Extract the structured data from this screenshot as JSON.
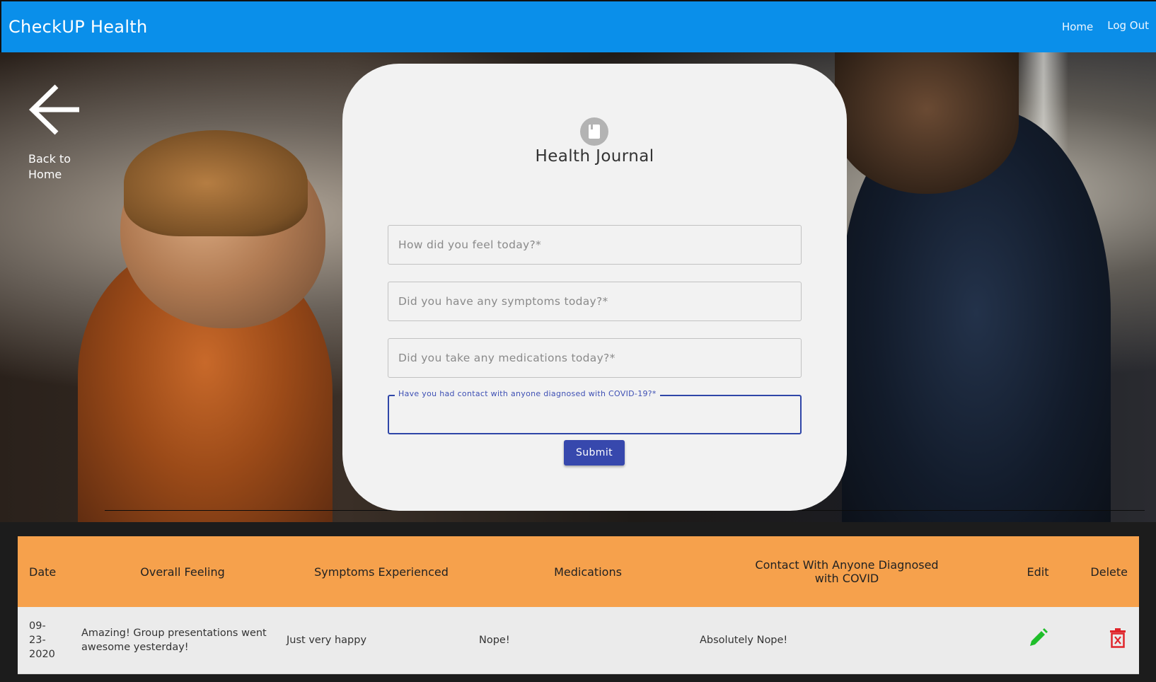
{
  "navbar": {
    "brand": "CheckUP Health",
    "links": {
      "home": "Home",
      "logout": "Log Out"
    },
    "color": "#0a8fea"
  },
  "back": {
    "label_line1": "Back to",
    "label_line2": "Home",
    "icon": "arrow-left-icon"
  },
  "journal": {
    "icon": "book-icon",
    "title": "Health Journal",
    "fields": {
      "feel": {
        "placeholder": "How did you feel today?*",
        "value": ""
      },
      "symptoms": {
        "placeholder": "Did you have any symptoms today?*",
        "value": ""
      },
      "medications": {
        "placeholder": "Did you take any medications today?*",
        "value": ""
      },
      "contact": {
        "label": "Have you had contact with anyone diagnosed with COVID-19?*",
        "value": ""
      }
    },
    "submit_label": "Submit",
    "accent": "#3748ad"
  },
  "table": {
    "header_color": "#f6a14c",
    "columns": {
      "date": "Date",
      "feeling": "Overall Feeling",
      "symptoms": "Symptoms Experienced",
      "medications": "Medications",
      "contact_line1": "Contact With Anyone Diagnosed",
      "contact_line2": "with COVID",
      "edit": "Edit",
      "delete": "Delete"
    },
    "rows": [
      {
        "date_parts": [
          "09-",
          "23-",
          "2020"
        ],
        "feeling": "Amazing! Group presentations went awesome yesterday!",
        "symptoms": "Just very happy",
        "medications": "Nope!",
        "contact": "Absolutely Nope!",
        "edit_icon": "pencil-icon",
        "delete_icon": "trash-icon",
        "edit_color": "#1fbe2a",
        "delete_color": "#e0242a"
      }
    ]
  }
}
